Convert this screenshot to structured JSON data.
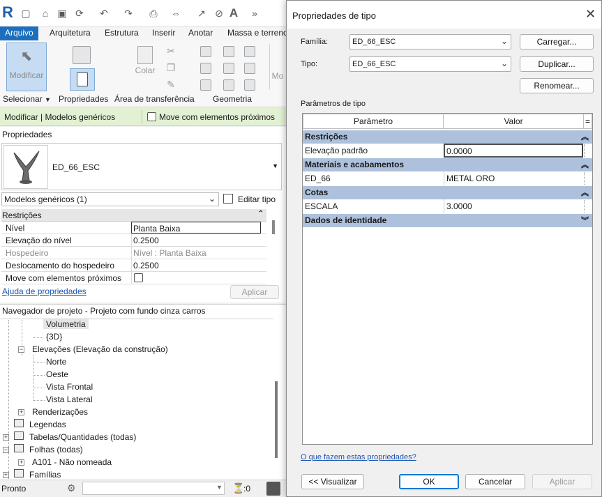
{
  "qat": {
    "logo": "R"
  },
  "ribbon": {
    "tabs": [
      "Arquivo",
      "Arquitetura",
      "Estrutura",
      "Inserir",
      "Anotar",
      "Massa e terreno"
    ],
    "modify_label": "Modificar",
    "paste_label": "Colar",
    "panels": [
      "Selecionar",
      "Propriedades",
      "Área de transferência",
      "Geometria"
    ],
    "partial_label": "Mo"
  },
  "context_bar": {
    "title": "Modificar | Modelos genéricos",
    "checkbox_label": "Move com elementos próximos"
  },
  "properties": {
    "title": "Propriedades",
    "type_name": "ED_66_ESC",
    "filter_value": "Modelos genéricos (1)",
    "edit_type_label": "Editar tipo",
    "category": "Restrições",
    "rows": [
      {
        "key": "Nível",
        "value": "Planta Baixa"
      },
      {
        "key": "Elevação do nível",
        "value": "0.2500"
      },
      {
        "key": "Hospedeiro",
        "value": "Nível : Planta Baixa"
      },
      {
        "key": "Deslocamento do hospedeiro",
        "value": "0.2500"
      },
      {
        "key": "Move com elementos próximos",
        "value": ""
      }
    ],
    "help_link": "Ajuda de propriedades",
    "apply_label": "Aplicar"
  },
  "browser": {
    "title": "Navegador de projeto - Projeto com fundo cinza carros",
    "items": {
      "volumetria": "Volumetria",
      "three_d": "{3D}",
      "elevacoes": "Elevações (Elevação da construção)",
      "norte": "Norte",
      "oeste": "Oeste",
      "vista_frontal": "Vista Frontal",
      "vista_lateral": "Vista Lateral",
      "renderizacoes": "Renderizações",
      "legendas": "Legendas",
      "tabelas": "Tabelas/Quantidades (todas)",
      "folhas": "Folhas (todas)",
      "a101": "A101 - Não nomeada",
      "familias": "Famílias"
    }
  },
  "status": {
    "text": "Pronto",
    "counter": ":0"
  },
  "dialog": {
    "title": "Propriedades de tipo",
    "familia_label": "Família:",
    "familia_value": "ED_66_ESC",
    "tipo_label": "Tipo:",
    "tipo_value": "ED_66_ESC",
    "carregar": "Carregar...",
    "duplicar": "Duplicar...",
    "renomear": "Renomear...",
    "params_label": "Parâmetros de tipo",
    "col_param": "Parâmetro",
    "col_valor": "Valor",
    "col_eq": "=",
    "groups": {
      "restricoes": "Restrições",
      "materiais": "Materiais e acabamentos",
      "cotas": "Cotas",
      "identidade": "Dados de identidade"
    },
    "rows": {
      "elevacao_k": "Elevação padrão",
      "elevacao_v": "0.0000",
      "ed66_k": "ED_66",
      "ed66_v": "METAL ORO",
      "escala_k": "ESCALA",
      "escala_v": "3.0000"
    },
    "help_link": "O que fazem estas propriedades?",
    "visualizar": "<< Visualizar",
    "ok": "OK",
    "cancelar": "Cancelar",
    "aplicar": "Aplicar"
  },
  "colors": {
    "accent": "#1d6fbd",
    "context_bar": "#e2f0d3",
    "group_header": "#adc1dc"
  }
}
